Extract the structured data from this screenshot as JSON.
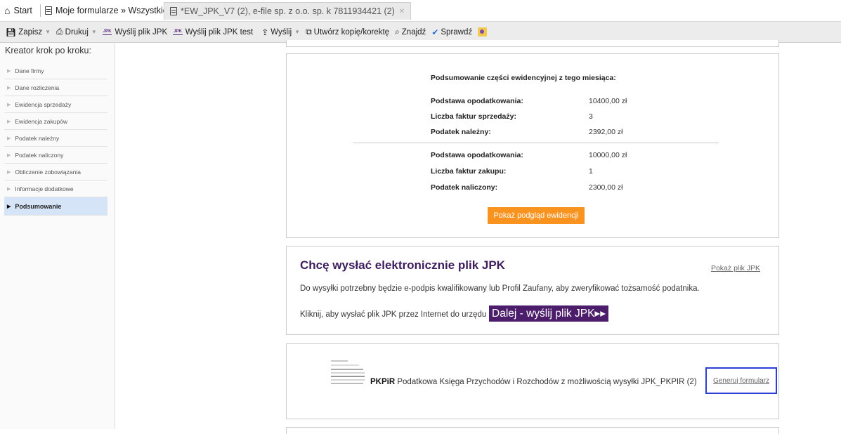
{
  "tabs": [
    {
      "label": "Start",
      "icon": "home-icon"
    },
    {
      "label": "Moje formularze » Wszystkie",
      "icon": "document-icon"
    },
    {
      "label": "*EW_JPK_V7 (2), e-file sp. z o.o. sp. k 7811934421 (2)",
      "icon": "document-icon"
    }
  ],
  "toolbar": {
    "save": "Zapisz",
    "print": "Drukuj",
    "send_jpk": "Wyślij plik JPK",
    "send_jpk_test": "Wyślij plik JPK test",
    "send": "Wyślij",
    "copy": "Utwórz kopię/korektę",
    "find": "Znajdź",
    "check": "Sprawdź"
  },
  "sidebar": {
    "title": "Kreator krok po kroku:",
    "items": [
      {
        "label": "Dane firmy"
      },
      {
        "label": "Dane rozliczenia"
      },
      {
        "label": "Ewidencja sprzedaży"
      },
      {
        "label": "Ewidencja zakupów"
      },
      {
        "label": "Podatek należny"
      },
      {
        "label": "Podatek naliczony"
      },
      {
        "label": "Obliczenie zobowiązania"
      },
      {
        "label": "Informacje dodatkowe"
      },
      {
        "label": "Podsumowanie"
      }
    ]
  },
  "summary": {
    "heading": "Podsumowanie części ewidencyjnej z tego miesiąca:",
    "rows": [
      {
        "label": "Podstawa opodatkowania:",
        "value": "10400,00 zł"
      },
      {
        "label": "Liczba faktur sprzedaży:",
        "value": "3"
      },
      {
        "label": "Podatek należny:",
        "value": "2392,00 zł"
      },
      {
        "label": "Podstawa opodatkowania:",
        "value": "10000,00 zł"
      },
      {
        "label": "Liczba faktur zakupu:",
        "value": "1"
      },
      {
        "label": "Podatek naliczony:",
        "value": "2300,00 zł"
      }
    ],
    "preview_button": "Pokaż podgląd ewidencji"
  },
  "send": {
    "title": "Chcę wysłać elektronicznie plik JPK",
    "show_link": "Pokaż plik JPK",
    "description": "Do wysyłki potrzebny będzie e-podpis kwalifikowany lub Profil Zaufany, aby zweryfikować tożsamość podatnika.",
    "cta_text": "Kliknij, aby wysłać plik JPK przez Internet do urzędu",
    "cta_button": "Dalej - wyślij plik JPK▸▸"
  },
  "pkpir": {
    "bold": "PKPiR",
    "text": " Podatkowa Księga Przychodów i Rozchodów z możliwością wysyłki JPK_PKPIR (2)",
    "link": "Generuj formularz"
  },
  "colors": {
    "accent_purple": "#4b1d6b",
    "orange": "#f7931e",
    "highlight_border": "#2c3ed6",
    "sidebar_active": "#d6e4f7"
  }
}
